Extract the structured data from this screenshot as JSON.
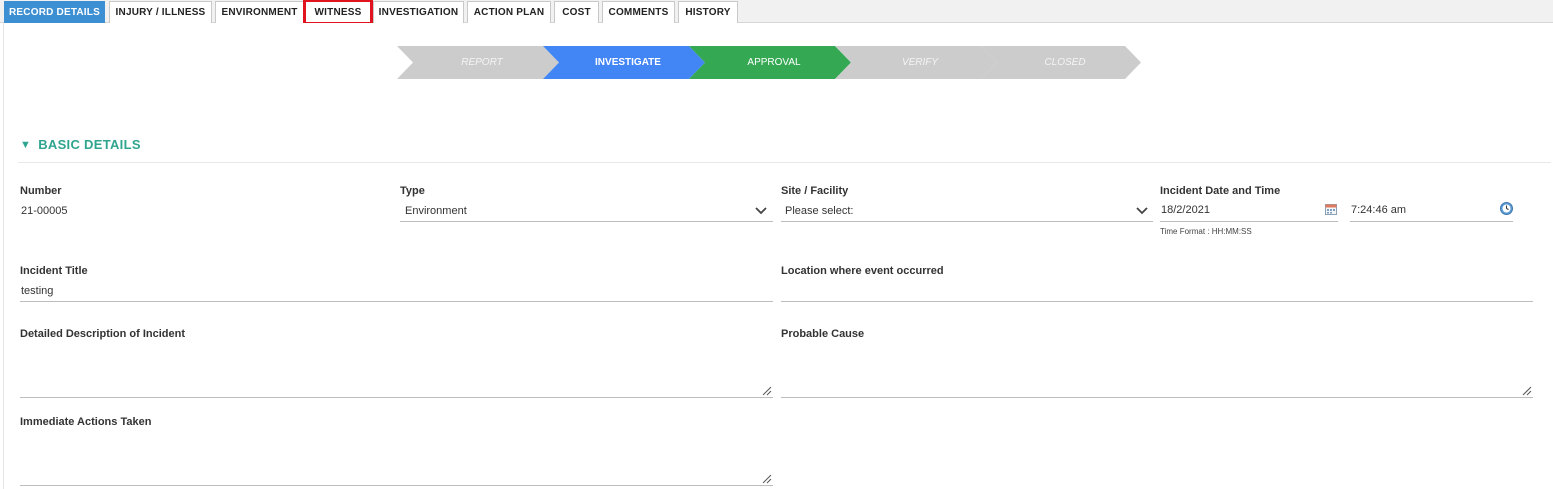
{
  "tabs": [
    {
      "label": "RECORD DETAILS",
      "active": true
    },
    {
      "label": "INJURY / ILLNESS"
    },
    {
      "label": "ENVIRONMENT"
    },
    {
      "label": "WITNESS",
      "highlighted": true
    },
    {
      "label": "INVESTIGATION"
    },
    {
      "label": "ACTION PLAN"
    },
    {
      "label": "COST"
    },
    {
      "label": "COMMENTS"
    },
    {
      "label": "HISTORY"
    }
  ],
  "workflow": [
    {
      "label": "REPORT",
      "state": "inactive"
    },
    {
      "label": "INVESTIGATE",
      "state": "current"
    },
    {
      "label": "APPROVAL",
      "state": "next"
    },
    {
      "label": "VERIFY",
      "state": "inactive"
    },
    {
      "label": "CLOSED",
      "state": "inactive"
    }
  ],
  "colors": {
    "active_tab": "#3c8fd3",
    "step_inactive": "#cccccc",
    "step_current": "#4285f4",
    "step_next": "#34a853",
    "section_title": "#2fa58f",
    "highlight_box": "#e0141e"
  },
  "section": {
    "title": "BASIC DETAILS",
    "caret_icon": "triangle-down-icon"
  },
  "fields": {
    "number": {
      "label": "Number",
      "value": "21-00005"
    },
    "type": {
      "label": "Type",
      "value": "Environment"
    },
    "site": {
      "label": "Site / Facility",
      "value": "Please select:"
    },
    "incident_datetime": {
      "label": "Incident Date and Time",
      "date": "18/2/2021",
      "time": "7:24:46 am",
      "hint": "Time Format : HH:MM:SS",
      "date_icon": "calendar-icon",
      "time_icon": "clock-icon"
    },
    "incident_title": {
      "label": "Incident Title",
      "value": "testing"
    },
    "location": {
      "label": "Location where event occurred",
      "value": ""
    },
    "description": {
      "label": "Detailed Description of Incident",
      "value": ""
    },
    "probable_cause": {
      "label": "Probable Cause",
      "value": ""
    },
    "immediate_actions": {
      "label": "Immediate Actions Taken",
      "value": ""
    }
  }
}
